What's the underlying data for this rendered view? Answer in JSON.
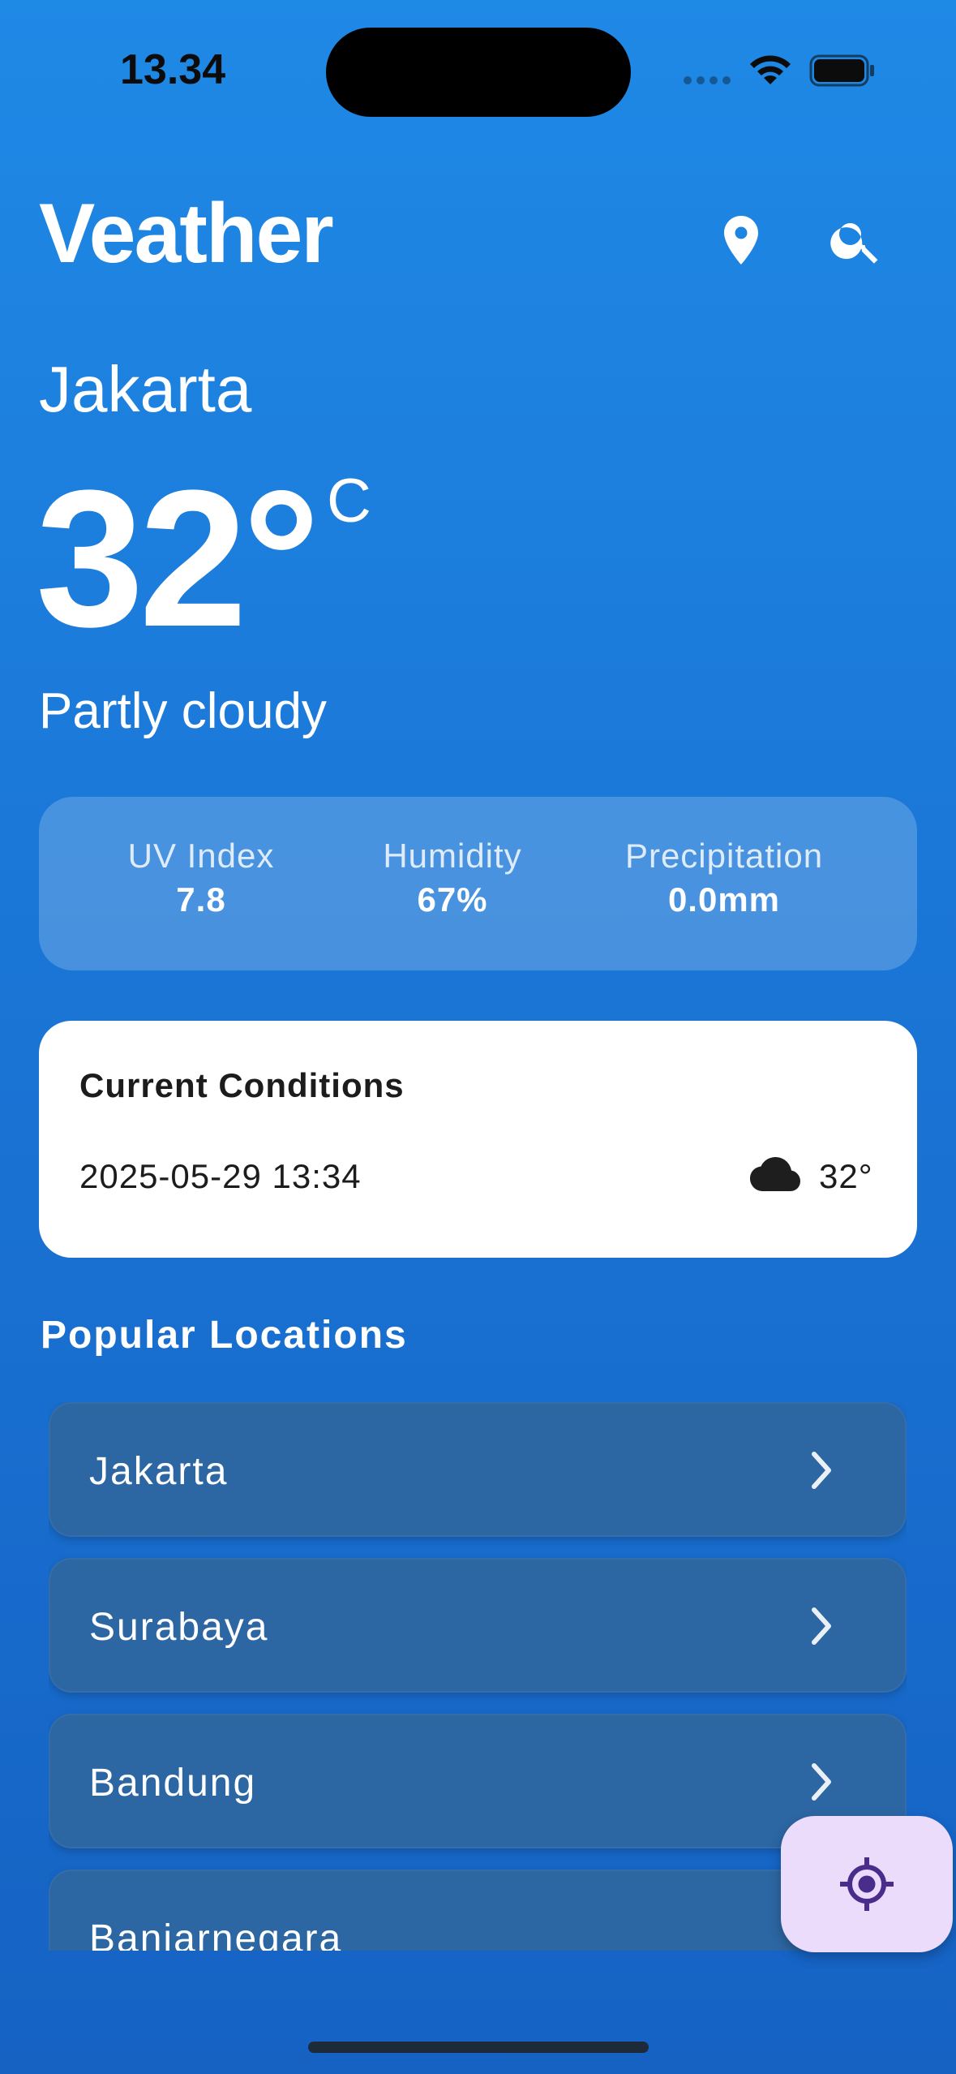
{
  "status_bar": {
    "time": "13.34"
  },
  "header": {
    "title": "Veather",
    "location_icon": "map-pin-icon",
    "search_icon": "search-icon"
  },
  "current": {
    "city": "Jakarta",
    "temperature": "32°",
    "unit": "C",
    "condition": "Partly cloudy"
  },
  "stats": [
    {
      "label": "UV Index",
      "value": "7.8"
    },
    {
      "label": "Humidity",
      "value": "67%"
    },
    {
      "label": "Precipitation",
      "value": "0.0mm"
    }
  ],
  "conditions_card": {
    "title": "Current Conditions",
    "timestamp": "2025-05-29 13:34",
    "icon": "cloud-icon",
    "temperature": "32°"
  },
  "popular": {
    "title": "Popular Locations",
    "items": [
      {
        "name": "Jakarta"
      },
      {
        "name": "Surabaya"
      },
      {
        "name": "Bandung"
      },
      {
        "name": "Banjarnegara"
      }
    ]
  },
  "fab": {
    "icon": "my-location-icon"
  },
  "colors": {
    "background_top": "#1f89e6",
    "background_bottom": "#1562c3",
    "list_item": "#2c66a3",
    "fab_bg": "#ecdcfc",
    "fab_icon": "#4a2d8a"
  }
}
